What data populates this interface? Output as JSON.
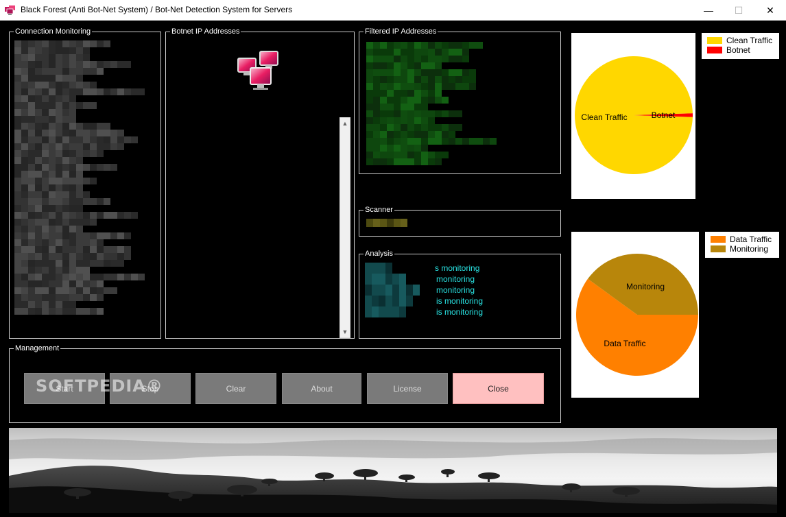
{
  "window": {
    "title": "Black Forest (Anti Bot-Net System) / Bot-Net Detection System for Servers",
    "min_glyph": "—",
    "max_glyph": "☐",
    "close_glyph": "✕"
  },
  "groups": {
    "connection": "Connection Monitoring",
    "botnet": "Botnet IP Addresses",
    "filtered": "Filtered IP Addresses",
    "scanner": "Scanner",
    "analysis": "Analysis",
    "management": "Management"
  },
  "analysis_lines": [
    "s monitoring",
    " monitoring",
    " monitoring",
    " is monitoring",
    " is monitoring"
  ],
  "buttons": {
    "start": "Start",
    "stop": "Stop",
    "clear": "Clear",
    "about": "About",
    "license": "License",
    "close": "Close"
  },
  "watermark": "SOFTPEDIA®",
  "icons": {
    "app": "computers-icon",
    "botnet": "network-computers-icon",
    "scroll_up": "▲",
    "scroll_down": "▼"
  },
  "colors": {
    "clean_traffic": "#ffd700",
    "botnet": "#ff0000",
    "data_traffic": "#ff8000",
    "monitoring": "#b8860b",
    "analysis_text": "#29e3e3",
    "close_button": "#ffc0c0"
  },
  "chart_data": [
    {
      "type": "pie",
      "categories": [
        "Clean Traffic",
        "Botnet"
      ],
      "values": [
        99,
        1
      ],
      "legend": [
        "Clean Traffic",
        "Botnet"
      ],
      "colors": [
        "#ffd700",
        "#ff0000"
      ]
    },
    {
      "type": "pie",
      "categories": [
        "Data Traffic",
        "Monitoring"
      ],
      "values": [
        60,
        40
      ],
      "legend": [
        "Data Traffic",
        "Monitoring"
      ],
      "colors": [
        "#ff8000",
        "#b8860b"
      ]
    }
  ]
}
